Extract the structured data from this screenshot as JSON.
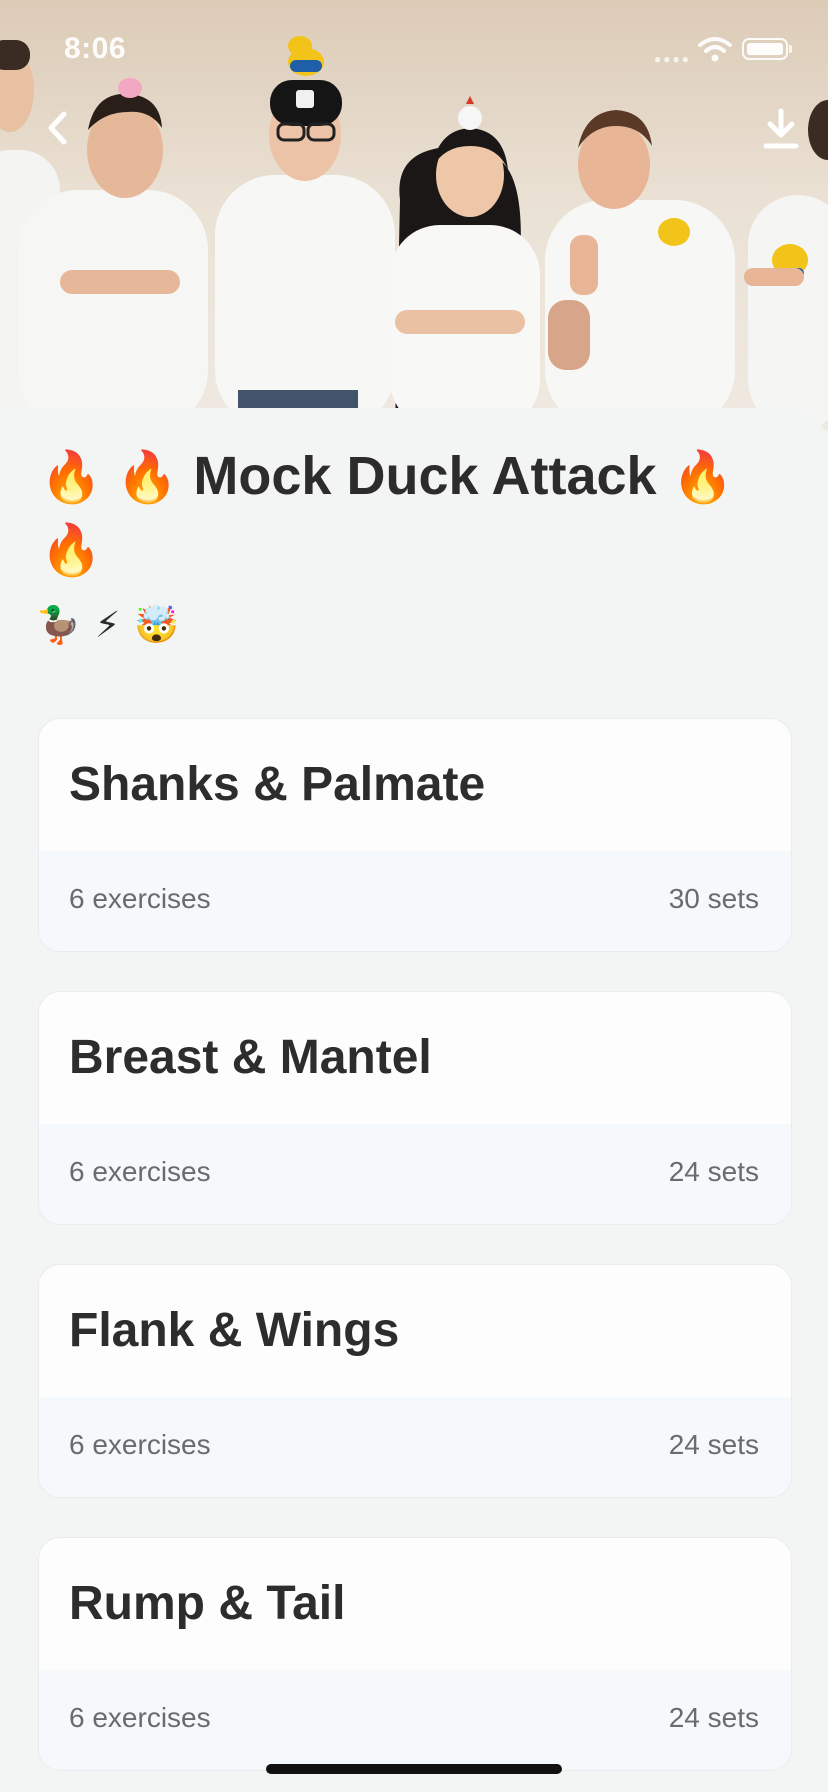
{
  "status_bar": {
    "time": "8:06"
  },
  "header": {
    "back_icon": "chevron-left-icon",
    "download_icon": "download-icon"
  },
  "routine": {
    "title_prefix": "🔥 🔥",
    "title": "Mock Duck Attack",
    "title_suffix": "🔥 🔥",
    "emojis": [
      "🦆",
      "⚡",
      "🤯"
    ]
  },
  "workouts": [
    {
      "name": "Shanks & Palmate",
      "exercises": "6 exercises",
      "sets": "30 sets"
    },
    {
      "name": "Breast & Mantel",
      "exercises": "6 exercises",
      "sets": "24 sets"
    },
    {
      "name": "Flank & Wings",
      "exercises": "6 exercises",
      "sets": "24 sets"
    },
    {
      "name": "Rump & Tail",
      "exercises": "6 exercises",
      "sets": "24 sets"
    }
  ]
}
